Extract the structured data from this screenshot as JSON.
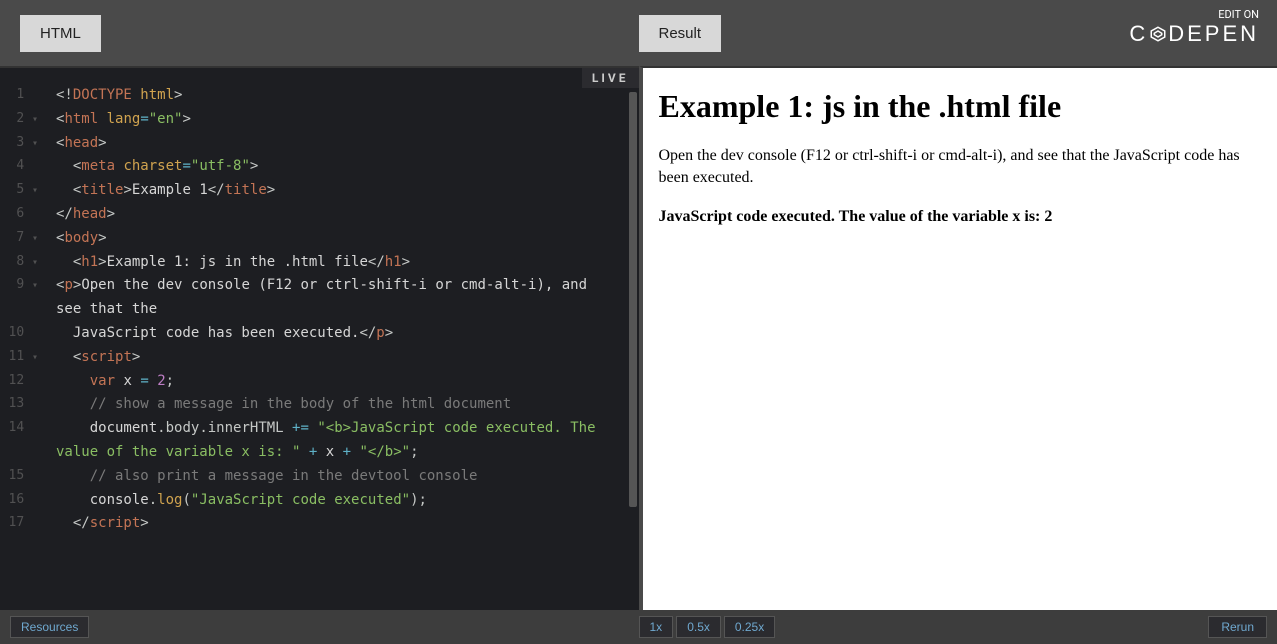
{
  "header": {
    "html_tab": "HTML",
    "result_tab": "Result",
    "edit_on_label": "EDIT ON",
    "brand": "CODEPEN"
  },
  "editor": {
    "live_badge": "LIVE",
    "lines": [
      {
        "n": "1",
        "fold": "",
        "seg": [
          [
            "bracket",
            "<!"
          ],
          [
            "tag",
            "DOCTYPE"
          ],
          [
            "attr",
            " html"
          ],
          [
            "bracket",
            ">"
          ]
        ]
      },
      {
        "n": "2",
        "fold": "▾",
        "seg": [
          [
            "bracket",
            "<"
          ],
          [
            "tag",
            "html"
          ],
          [
            "attr",
            " lang"
          ],
          [
            "op",
            "="
          ],
          [
            "string",
            "\"en\""
          ],
          [
            "bracket",
            ">"
          ]
        ]
      },
      {
        "n": "3",
        "fold": "▾",
        "seg": [
          [
            "bracket",
            "<"
          ],
          [
            "tag",
            "head"
          ],
          [
            "bracket",
            ">"
          ]
        ]
      },
      {
        "n": "4",
        "fold": "",
        "seg": [
          [
            "text",
            "  "
          ],
          [
            "bracket",
            "<"
          ],
          [
            "tag",
            "meta"
          ],
          [
            "attr",
            " charset"
          ],
          [
            "op",
            "="
          ],
          [
            "string",
            "\"utf-8\""
          ],
          [
            "bracket",
            ">"
          ]
        ]
      },
      {
        "n": "5",
        "fold": "▾",
        "seg": [
          [
            "text",
            "  "
          ],
          [
            "bracket",
            "<"
          ],
          [
            "tag",
            "title"
          ],
          [
            "bracket",
            ">"
          ],
          [
            "text",
            "Example 1"
          ],
          [
            "bracket",
            "</"
          ],
          [
            "tag",
            "title"
          ],
          [
            "bracket",
            ">"
          ]
        ]
      },
      {
        "n": "6",
        "fold": "",
        "seg": [
          [
            "bracket",
            "</"
          ],
          [
            "tag",
            "head"
          ],
          [
            "bracket",
            ">"
          ]
        ]
      },
      {
        "n": "7",
        "fold": "▾",
        "seg": [
          [
            "bracket",
            "<"
          ],
          [
            "tag",
            "body"
          ],
          [
            "bracket",
            ">"
          ]
        ]
      },
      {
        "n": "8",
        "fold": "▾",
        "seg": [
          [
            "text",
            "  "
          ],
          [
            "bracket",
            "<"
          ],
          [
            "tag",
            "h1"
          ],
          [
            "bracket",
            ">"
          ],
          [
            "text",
            "Example 1: js in the .html file"
          ],
          [
            "bracket",
            "</"
          ],
          [
            "tag",
            "h1"
          ],
          [
            "bracket",
            ">"
          ]
        ]
      },
      {
        "n": "9",
        "fold": "▾",
        "seg": [
          [
            "bracket",
            "<"
          ],
          [
            "tag",
            "p"
          ],
          [
            "bracket",
            ">"
          ],
          [
            "text",
            "Open the dev console (F12 or ctrl-shift-i or cmd-alt-i), and see that the "
          ]
        ]
      },
      {
        "n": "10",
        "fold": "",
        "seg": [
          [
            "text",
            "  JavaScript code has been executed."
          ],
          [
            "bracket",
            "</"
          ],
          [
            "tag",
            "p"
          ],
          [
            "bracket",
            ">"
          ]
        ]
      },
      {
        "n": "11",
        "fold": "▾",
        "seg": [
          [
            "text",
            "  "
          ],
          [
            "bracket",
            "<"
          ],
          [
            "tag",
            "script"
          ],
          [
            "bracket",
            ">"
          ]
        ]
      },
      {
        "n": "12",
        "fold": "",
        "seg": [
          [
            "text",
            "    "
          ],
          [
            "tag",
            "var"
          ],
          [
            "text",
            " x "
          ],
          [
            "op",
            "="
          ],
          [
            "text",
            " "
          ],
          [
            "num",
            "2"
          ],
          [
            "punc",
            ";"
          ]
        ]
      },
      {
        "n": "13",
        "fold": "",
        "seg": [
          [
            "text",
            "    "
          ],
          [
            "comment",
            "// show a message in the body of the html document"
          ]
        ]
      },
      {
        "n": "14",
        "fold": "",
        "seg": [
          [
            "text",
            "    document"
          ],
          [
            "punc",
            "."
          ],
          [
            "prop",
            "body"
          ],
          [
            "punc",
            "."
          ],
          [
            "prop",
            "innerHTML"
          ],
          [
            "text",
            " "
          ],
          [
            "op",
            "+="
          ],
          [
            "text",
            " "
          ],
          [
            "string",
            "\"<b>JavaScript code executed. The value of the variable x is: \""
          ],
          [
            "text",
            " "
          ],
          [
            "op",
            "+"
          ],
          [
            "text",
            " x "
          ],
          [
            "op",
            "+"
          ],
          [
            "text",
            " "
          ],
          [
            "string",
            "\"</b>\""
          ],
          [
            "punc",
            ";"
          ]
        ]
      },
      {
        "n": "15",
        "fold": "",
        "seg": [
          [
            "text",
            "    "
          ],
          [
            "comment",
            "// also print a message in the devtool console"
          ]
        ]
      },
      {
        "n": "16",
        "fold": "",
        "seg": [
          [
            "text",
            "    console"
          ],
          [
            "punc",
            "."
          ],
          [
            "attr",
            "log"
          ],
          [
            "punc",
            "("
          ],
          [
            "string",
            "\"JavaScript code executed\""
          ],
          [
            "punc",
            ")"
          ],
          [
            "punc",
            ";"
          ]
        ]
      },
      {
        "n": "17",
        "fold": "",
        "seg": [
          [
            "text",
            "  "
          ],
          [
            "bracket",
            "</"
          ],
          [
            "tag",
            "script"
          ],
          [
            "bracket",
            ">"
          ]
        ]
      }
    ]
  },
  "result": {
    "heading": "Example 1: js in the .html file",
    "paragraph": "Open the dev console (F12 or ctrl-shift-i or cmd-alt-i), and see that the JavaScript code has been executed.",
    "bold_output": "JavaScript code executed. The value of the variable x is: 2"
  },
  "footer": {
    "resources": "Resources",
    "zoom_1x": "1x",
    "zoom_05x": "0.5x",
    "zoom_025x": "0.25x",
    "rerun": "Rerun"
  }
}
